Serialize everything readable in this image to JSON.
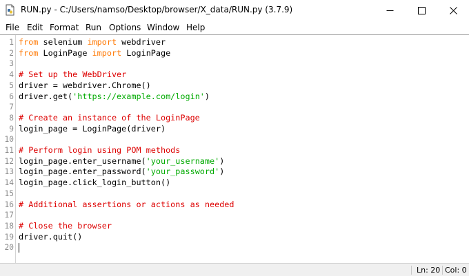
{
  "window": {
    "title": "RUN.py - C:/Users/namso/Desktop/browser/X_data/RUN.py (3.7.9)",
    "app_icon": "idle-python-file-icon",
    "controls": [
      "minimize-icon",
      "maximize-icon",
      "close-icon"
    ]
  },
  "menu": {
    "items": [
      "File",
      "Edit",
      "Format",
      "Run",
      "Options",
      "Window",
      "Help"
    ]
  },
  "editor": {
    "line_numbers": [
      "1",
      "2",
      "3",
      "4",
      "5",
      "6",
      "7",
      "8",
      "9",
      "10",
      "11",
      "12",
      "13",
      "14",
      "15",
      "16",
      "17",
      "18",
      "19",
      "20"
    ],
    "lines": [
      [
        {
          "t": "from",
          "c": "kw"
        },
        {
          "t": " selenium ",
          "c": ""
        },
        {
          "t": "import",
          "c": "kw"
        },
        {
          "t": " webdriver",
          "c": ""
        }
      ],
      [
        {
          "t": "from",
          "c": "kw"
        },
        {
          "t": " LoginPage ",
          "c": ""
        },
        {
          "t": "import",
          "c": "kw"
        },
        {
          "t": " LoginPage",
          "c": ""
        }
      ],
      [],
      [
        {
          "t": "# Set up the WebDriver",
          "c": "cm"
        }
      ],
      [
        {
          "t": "driver = webdriver.Chrome()",
          "c": ""
        }
      ],
      [
        {
          "t": "driver.get(",
          "c": ""
        },
        {
          "t": "'https://example.com/login'",
          "c": "st"
        },
        {
          "t": ")",
          "c": ""
        }
      ],
      [],
      [
        {
          "t": "# Create an instance of the LoginPage",
          "c": "cm"
        }
      ],
      [
        {
          "t": "login_page = LoginPage(driver)",
          "c": ""
        }
      ],
      [],
      [
        {
          "t": "# Perform login using POM methods",
          "c": "cm"
        }
      ],
      [
        {
          "t": "login_page.enter_username(",
          "c": ""
        },
        {
          "t": "'your_username'",
          "c": "st"
        },
        {
          "t": ")",
          "c": ""
        }
      ],
      [
        {
          "t": "login_page.enter_password(",
          "c": ""
        },
        {
          "t": "'your_password'",
          "c": "st"
        },
        {
          "t": ")",
          "c": ""
        }
      ],
      [
        {
          "t": "login_page.click_login_button()",
          "c": ""
        }
      ],
      [],
      [
        {
          "t": "# Additional assertions or actions as needed",
          "c": "cm"
        }
      ],
      [],
      [
        {
          "t": "# Close the browser",
          "c": "cm"
        }
      ],
      [
        {
          "t": "driver.quit()",
          "c": ""
        }
      ],
      []
    ],
    "colors": {
      "keyword": "#ff7700",
      "comment": "#dd0000",
      "string": "#00aa00",
      "line_number": "#8c8c8c"
    }
  },
  "status": {
    "line": "Ln: 20",
    "col": "Col: 0"
  }
}
